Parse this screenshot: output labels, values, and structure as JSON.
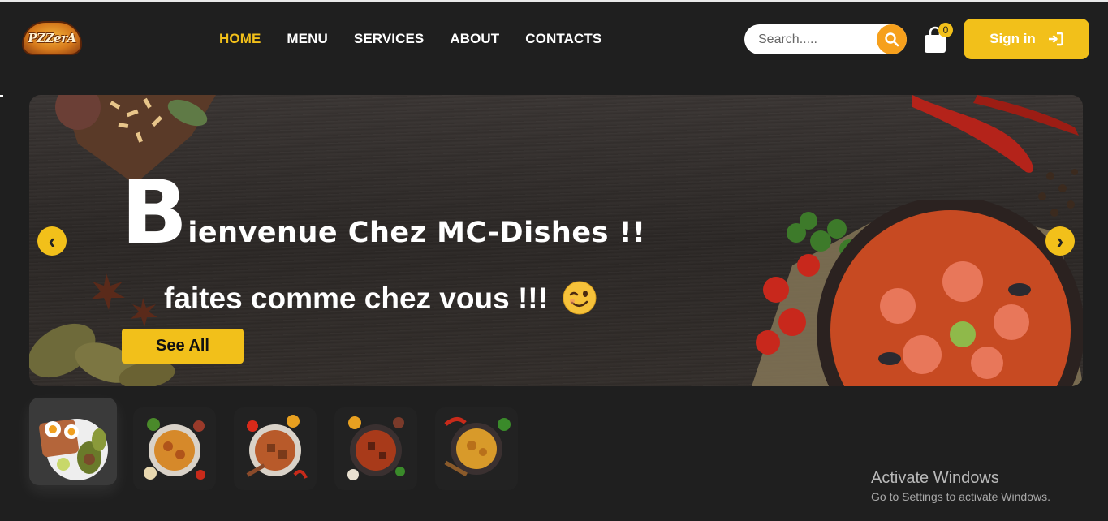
{
  "header": {
    "logo_text": "PZZerA",
    "nav": [
      "HOME",
      "MENU",
      "SERVICES",
      "ABOUT",
      "CONTACTS"
    ],
    "active_nav": "HOME",
    "search_placeholder": "Search.....",
    "cart_count": "0",
    "signin_label": "Sign in"
  },
  "hero": {
    "title_first_letter": "B",
    "title_rest": "ienvenue Chez MC-Dishes !!",
    "subtitle": "faites comme chez vous !!!",
    "button_label": "See All",
    "prev_arrow": "‹",
    "next_arrow": "›"
  },
  "thumbnails": [
    "egg-toast-plate",
    "curry-bowl-1",
    "curry-bowl-2",
    "curry-bowl-3",
    "curry-bowl-4"
  ],
  "watermark": {
    "title": "Activate Windows",
    "subtitle": "Go to Settings to activate Windows."
  },
  "colors": {
    "accent": "#f2c01a",
    "search_button": "#f6a01c",
    "background": "#1f1f1f"
  }
}
